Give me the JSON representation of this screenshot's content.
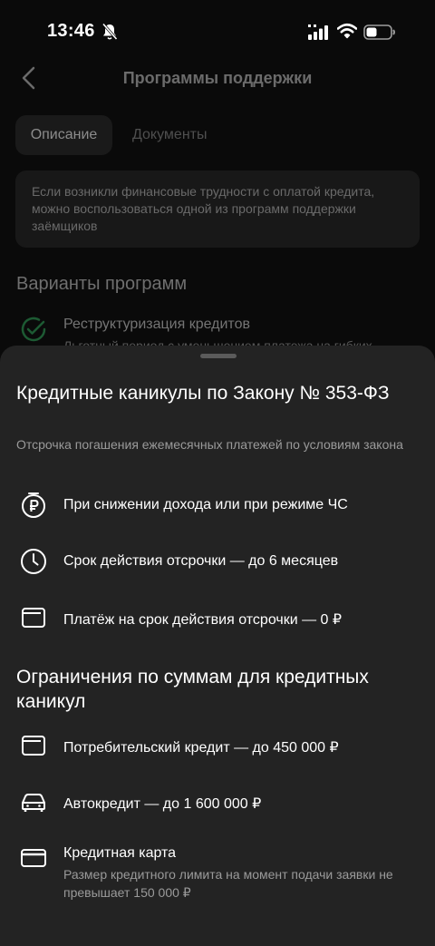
{
  "status_bar": {
    "time": "13:46"
  },
  "header": {
    "title": "Программы поддержки"
  },
  "tabs": [
    {
      "label": "Описание",
      "active": true
    },
    {
      "label": "Документы",
      "active": false
    }
  ],
  "info": {
    "text": "Если возникли финансовые трудности с оплатой кредита, можно воспользоваться одной из программ поддержки заёмщиков"
  },
  "programs": {
    "section_title": "Варианты программ",
    "items": [
      {
        "title": "Реструктуризация кредитов",
        "subtitle": "Льготный период с уменьшением платежа на гибких"
      }
    ]
  },
  "sheet": {
    "title": "Кредитные каникулы по Закону № 353-ФЗ",
    "subtitle": "Отсрочка погашения ежемесячных платежей по условиям закона",
    "conditions": [
      {
        "icon": "ruble-coin-icon",
        "text": "При снижении дохода или при режиме ЧС"
      },
      {
        "icon": "clock-icon",
        "text": "Срок действия отсрочки — до 6 месяцев"
      },
      {
        "icon": "wallet-icon",
        "text": "Платёж на срок действия отсрочки — 0 ₽"
      }
    ],
    "limits_title": "Ограничения по суммам для кредитных каникул",
    "limits": [
      {
        "icon": "wallet-icon",
        "text": "Потребительский кредит — до 450 000 ₽"
      },
      {
        "icon": "car-icon",
        "text": "Автокредит — до 1 600 000 ₽"
      },
      {
        "icon": "credit-card-icon",
        "text": "Кредитная карта",
        "subtitle": "Размер кредитного лимита на момент подачи заявки не превышает 150 000 ₽"
      }
    ]
  },
  "colors": {
    "sheet_bg": "#232323",
    "screen_bg": "#0a0a0a",
    "accent_green": "#1d6b3a"
  }
}
